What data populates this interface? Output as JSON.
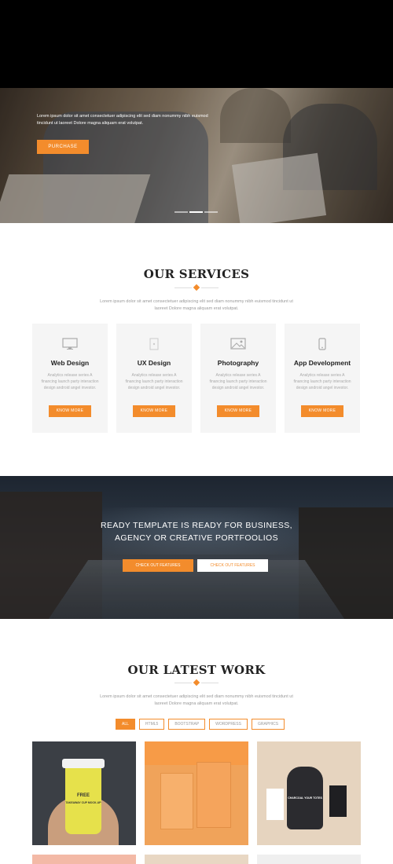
{
  "hero": {
    "text": "Lorem ipsum dolor sit amet consectetuer adipiscing elit sed diam nonummy nibh euismod tincidunt ut laoreet Dolore magna aliquam erat volutpat.",
    "button_label": "PURCHASE",
    "slides": 3,
    "active_slide": 2
  },
  "services": {
    "title": "OUR SERVICES",
    "subtitle": "Lorem ipsum dolor sit amet consectetuer adipiscing elit sed diam nonummy nibh euismod tincidunt ut laoreet Dolore magna aliquam erat volutpat.",
    "items": [
      {
        "icon": "monitor-icon",
        "title": "Web Design",
        "text": "Analytics release series A financing launch party interaction design android angel investor.",
        "button": "KNOW MORE"
      },
      {
        "icon": "ux-icon",
        "title": "UX Design",
        "text": "Analytics release series A financing launch party interaction design android angel investor.",
        "button": "KNOW MORE"
      },
      {
        "icon": "photo-icon",
        "title": "Photography",
        "text": "Analytics release series A financing launch party interaction design android angel investor.",
        "button": "KNOW MORE"
      },
      {
        "icon": "mobile-icon",
        "title": "App Development",
        "text": "Analytics release series A financing launch party interaction design android angel investor.",
        "button": "KNOW MORE"
      }
    ]
  },
  "cta": {
    "line1": "READY TEMPLATE IS READY FOR BUSINESS,",
    "line2": "AGENCY OR CREATIVE PORTFOOLIOS",
    "button_primary": "CHECK OUT FEATURES",
    "button_secondary": "CHECK OUT FEATURES"
  },
  "work": {
    "title": "OUR LATEST WORK",
    "subtitle": "Lorem ipsum dolor sit amet consectetuer adipiscing elit sed diam nonummy nibh euismod tincidunt ut laoreet Dolore magna aliquam erat volutpat.",
    "filters": [
      "ALL",
      "HTML5",
      "BOOTSTRAP",
      "WORDPRESS",
      "GRAPHICS"
    ],
    "active_filter": "ALL",
    "tile1_label": "FREE",
    "tile1_sub": "TAKEAWAY CUP MOCK-UP",
    "tile3_label": "CHARCOAL YOUR TOTES"
  },
  "colors": {
    "accent": "#f38c2c",
    "card_bg": "#f5f5f5",
    "heading": "#222222"
  }
}
